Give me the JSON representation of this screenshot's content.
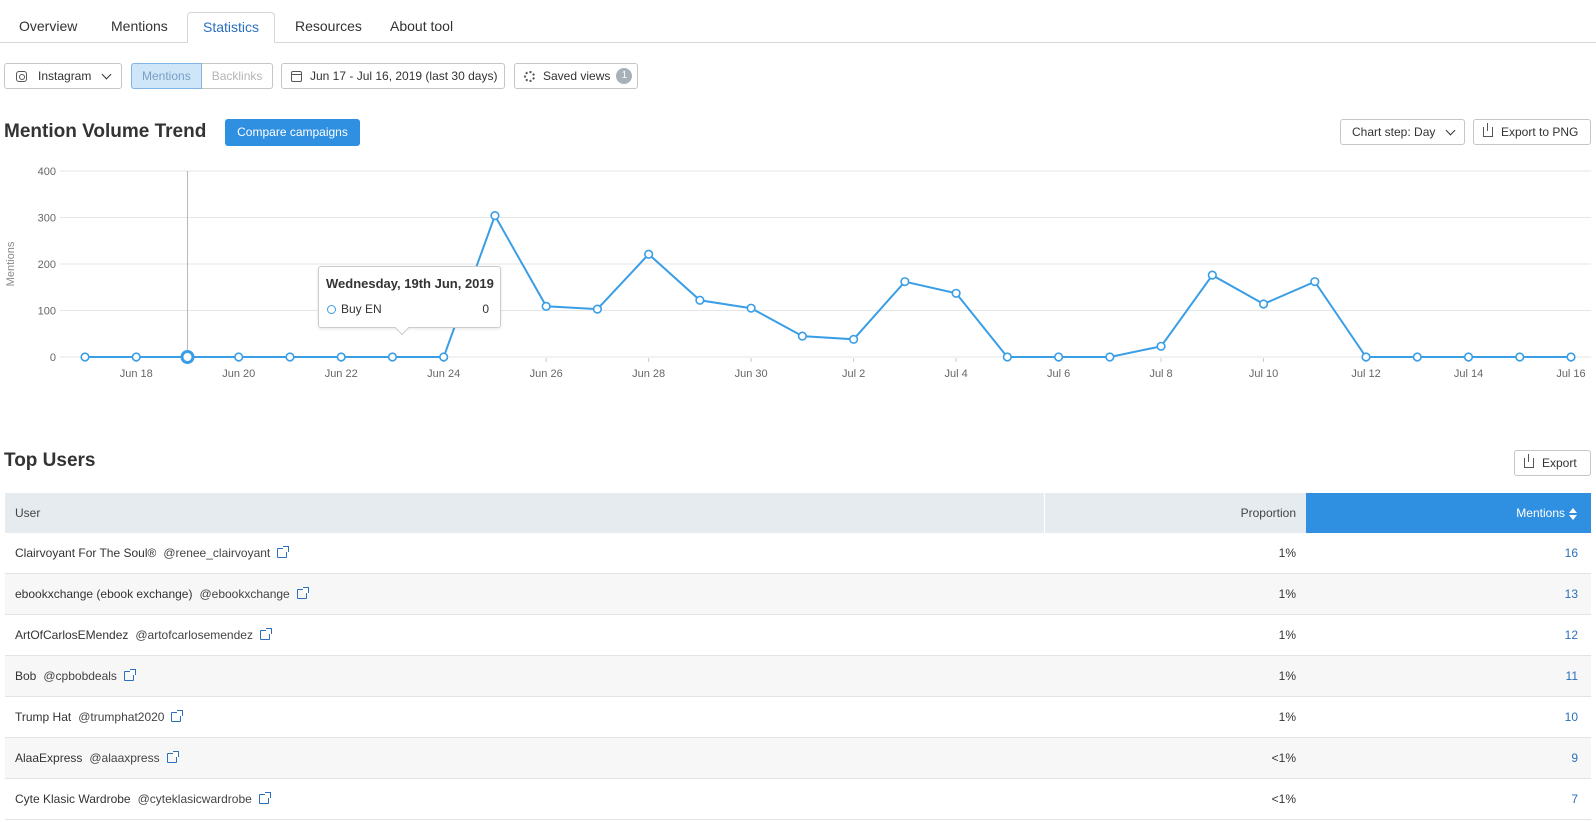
{
  "tabs": [
    {
      "label": "Overview",
      "active": false
    },
    {
      "label": "Mentions",
      "active": false
    },
    {
      "label": "Statistics",
      "active": true
    },
    {
      "label": "Resources",
      "active": false
    },
    {
      "label": "About tool",
      "active": false
    }
  ],
  "filters": {
    "source": "Instagram",
    "source_icon": "instagram-icon",
    "segment": {
      "mentions": "Mentions",
      "backlinks": "Backlinks",
      "selected": "Mentions"
    },
    "date_range": "Jun 17 - Jul 16, 2019 (last 30 days)",
    "saved_views": "Saved views",
    "saved_views_count": "1"
  },
  "trend": {
    "title": "Mention Volume Trend",
    "compare_button": "Compare campaigns",
    "chart_step": "Chart step: Day",
    "export_png": "Export to PNG"
  },
  "chart_data": {
    "type": "line",
    "title": "",
    "xlabel": "",
    "ylabel": "Mentions",
    "ylim": [
      0,
      400
    ],
    "yticks": [
      0,
      100,
      200,
      300,
      400
    ],
    "x": [
      "Jun 17",
      "Jun 18",
      "Jun 19",
      "Jun 20",
      "Jun 21",
      "Jun 22",
      "Jun 23",
      "Jun 24",
      "Jun 25",
      "Jun 26",
      "Jun 27",
      "Jun 28",
      "Jun 29",
      "Jun 30",
      "Jul 1",
      "Jul 2",
      "Jul 3",
      "Jul 4",
      "Jul 5",
      "Jul 6",
      "Jul 7",
      "Jul 8",
      "Jul 9",
      "Jul 10",
      "Jul 11",
      "Jul 12",
      "Jul 13",
      "Jul 14",
      "Jul 15",
      "Jul 16"
    ],
    "xtick_labels": [
      "Jun 18",
      "Jun 20",
      "Jun 22",
      "Jun 24",
      "Jun 26",
      "Jun 28",
      "Jun 30",
      "Jul 2",
      "Jul 4",
      "Jul 6",
      "Jul 8",
      "Jul 10",
      "Jul 12",
      "Jul 14",
      "Jul 16"
    ],
    "series": [
      {
        "name": "Buy EN",
        "color": "#3a9ee6",
        "values": [
          0,
          0,
          0,
          0,
          0,
          0,
          0,
          0,
          304,
          109,
          103,
          221,
          122,
          105,
          45,
          38,
          162,
          137,
          0,
          0,
          0,
          23,
          176,
          114,
          162,
          0,
          0,
          0,
          0,
          0
        ]
      }
    ],
    "highlighted_index": 2,
    "grid": true,
    "tooltip": {
      "title": "Wednesday, 19th Jun, 2019",
      "series": "Buy EN",
      "value": "0"
    }
  },
  "top_users": {
    "title": "Top Users",
    "export": "Export",
    "columns": {
      "user": "User",
      "proportion": "Proportion",
      "mentions": "Mentions"
    },
    "rows": [
      {
        "name": "Clairvoyant For The Soul®",
        "handle": "@renee_clairvoyant",
        "proportion": "1%",
        "mentions": "16"
      },
      {
        "name": "ebookxchange (ebook exchange)",
        "handle": "@ebookxchange",
        "proportion": "1%",
        "mentions": "13"
      },
      {
        "name": "ArtOfCarlosEMendez",
        "handle": "@artofcarlosemendez",
        "proportion": "1%",
        "mentions": "12"
      },
      {
        "name": "Bob",
        "handle": "@cpbobdeals",
        "proportion": "1%",
        "mentions": "11"
      },
      {
        "name": "Trump Hat",
        "handle": "@trumphat2020",
        "proportion": "1%",
        "mentions": "10"
      },
      {
        "name": "AlaaExpress",
        "handle": "@alaaxpress",
        "proportion": "<1%",
        "mentions": "9"
      },
      {
        "name": "Cyte Klasic Wardrobe",
        "handle": "@cyteklasicwardrobe",
        "proportion": "<1%",
        "mentions": "7"
      }
    ]
  },
  "colors": {
    "accent": "#2f8fe0",
    "link": "#2b6fbd",
    "line": "#3a9ee6",
    "header_bg": "#e6ebf0"
  }
}
